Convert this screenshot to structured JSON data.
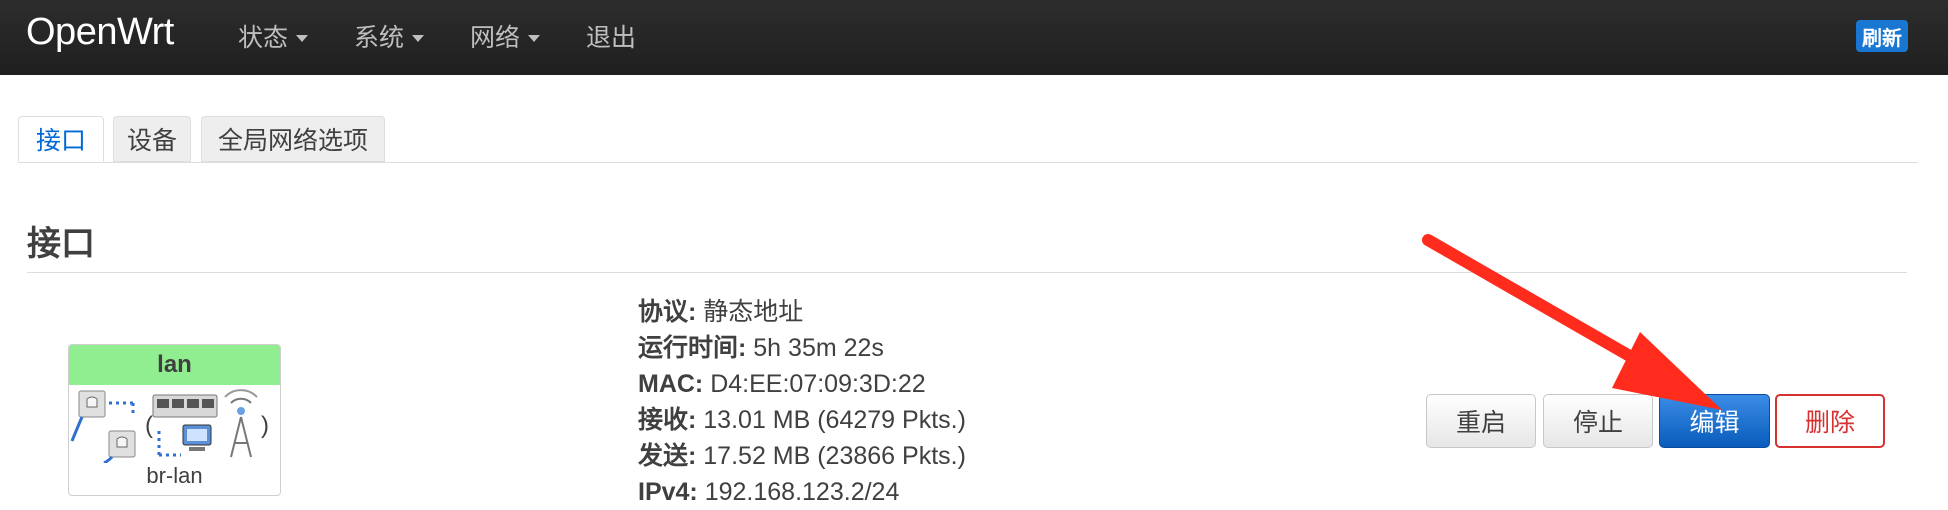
{
  "navbar": {
    "brand": "OpenWrt",
    "menu": [
      {
        "label": "状态"
      },
      {
        "label": "系统"
      },
      {
        "label": "网络"
      },
      {
        "label": "退出"
      }
    ],
    "refresh_label": "刷新"
  },
  "tabs": [
    {
      "label": "接口",
      "active": true
    },
    {
      "label": "设备",
      "active": false
    },
    {
      "label": "全局网络选项",
      "active": false
    }
  ],
  "section": {
    "title": "接口"
  },
  "interface": {
    "name": "lan",
    "device": "br-lan",
    "header_color": "#90ee90",
    "details": [
      {
        "key": "协议:",
        "value": "静态地址"
      },
      {
        "key": "运行时间:",
        "value": "5h 35m 22s"
      },
      {
        "key": "MAC:",
        "value": "D4:EE:07:09:3D:22"
      },
      {
        "key": "接收:",
        "value": "13.01 MB (64279 Pkts.)"
      },
      {
        "key": "发送:",
        "value": "17.52 MB (23866 Pkts.)"
      },
      {
        "key": "IPv4:",
        "value": "192.168.123.2/24"
      }
    ],
    "actions": {
      "restart": "重启",
      "stop": "停止",
      "edit": "编辑",
      "delete": "删除"
    }
  },
  "colors": {
    "navbar_bg": "#222222",
    "accent": "#0069d6",
    "danger": "#d63030",
    "annotation_arrow": "#ff2b1c"
  }
}
